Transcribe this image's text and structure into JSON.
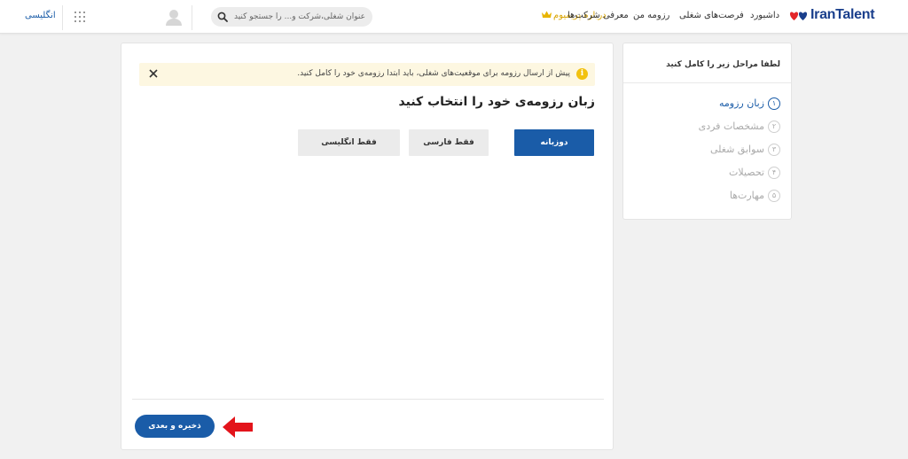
{
  "header": {
    "language_link": "انگلیسی",
    "search_placeholder": "عنوان شغلی،شرکت و... را جستجو کنید",
    "nav": {
      "dashboard": "داشبورد",
      "jobs": "فرصت‌های شغلی",
      "my_resume": "رزومه من",
      "companies": "معرفی شرکت‌ها",
      "premium": "درباره پریمیوم"
    },
    "logo_text": "IranTalent",
    "brand_color": "#1a3f8c",
    "premium_color": "#d9a400"
  },
  "alert": {
    "message": "پیش از ارسال رزومه برای موقعیت‌های شغلی، باید ابتدا رزومه‌ی خود را کامل کنید.",
    "icon": "info-icon",
    "close_icon": "close-icon"
  },
  "main": {
    "title": "زبان رزومه‌ی خود را انتخاب کنید",
    "options": {
      "bilingual": "دوزبانه",
      "persian_only": "فقط فارسی",
      "english_only": "فقط انگلیسی"
    },
    "selected_option": "دوزبانه",
    "save_button": "ذخیره و بعدی",
    "accent_color": "#1a5ca8"
  },
  "sidebar": {
    "title": "لطفا مراحل زیر را کامل کنید",
    "steps": [
      {
        "num": "١",
        "label": "زبان رزومه"
      },
      {
        "num": "٢",
        "label": "مشخصات فردی"
      },
      {
        "num": "٣",
        "label": "سوابق شغلی"
      },
      {
        "num": "۴",
        "label": "تحصیلات"
      },
      {
        "num": "۵",
        "label": "مهارت‌ها"
      }
    ],
    "active_step": 1
  }
}
